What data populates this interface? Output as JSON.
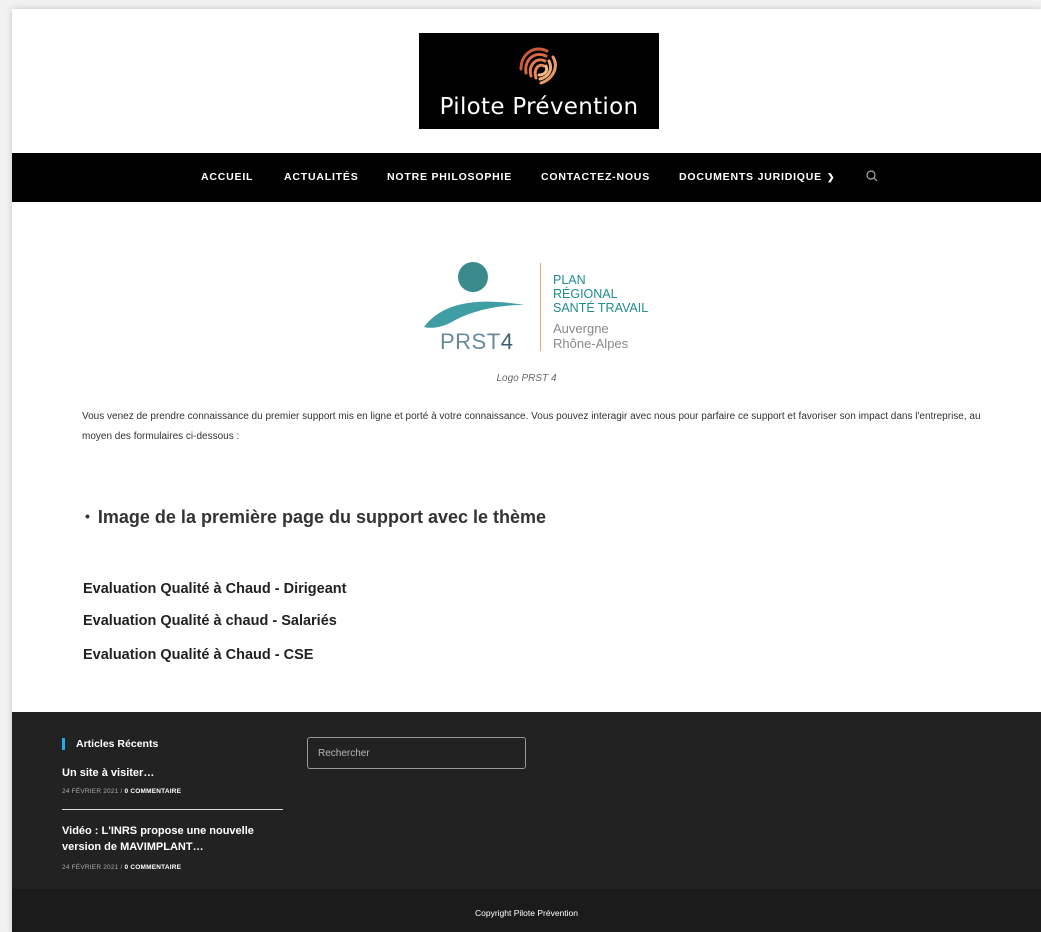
{
  "header": {
    "brand_name": "Pilote Prévention"
  },
  "nav": {
    "items": [
      {
        "label": "ACCUEIL"
      },
      {
        "label": "ACTUALITÉS"
      },
      {
        "label": "NOTRE PHILOSOPHIE"
      },
      {
        "label": "CONTACTEZ-NOUS"
      },
      {
        "label": "DOCUMENTS JURIDIQUE"
      }
    ],
    "search_icon": "search-icon",
    "dropdown_icon": "chevron-down-icon"
  },
  "prst_logo": {
    "name_prefix": "PRST",
    "name_number": "4",
    "line1": "PLAN",
    "line2": "RÉGIONAL",
    "line3": "SANTÉ TRAVAIL",
    "sub1": "Auvergne",
    "sub2": "Rhône-Alpes",
    "caption": "Logo PRST 4"
  },
  "main": {
    "intro": "Vous venez de prendre connaissance du premier support mis en ligne et porté à votre connaissance. Vous pouvez interagir avec nous pour parfaire ce support et favoriser son impact dans l'entreprise, au moyen des formulaires ci-dessous :",
    "image_title": "Image de la première page du support avec le thème",
    "evaluations": [
      "Evaluation Qualité à Chaud - Dirigeant",
      "Evaluation Qualité à chaud - Salariés",
      "Evaluation Qualité à Chaud - CSE"
    ]
  },
  "footer": {
    "widget_title": "Articles Récents",
    "posts": [
      {
        "title": "Un site à visiter…",
        "date": "24 FÉVRIER 2021 / ",
        "comments": "0 COMMENTAIRE"
      },
      {
        "title": "Vidéo : L'INRS propose une nouvelle version de MAVIMPLANT…",
        "date": "24 FÉVRIER 2021 / ",
        "comments": "0 COMMENTAIRE"
      }
    ],
    "search_placeholder": "Rechercher",
    "copyright": "Copyright Pilote Prévention"
  },
  "colors": {
    "accent": "#13aff0",
    "prst_teal": "#1f8c90",
    "prst_orange": "#e8a46d"
  }
}
